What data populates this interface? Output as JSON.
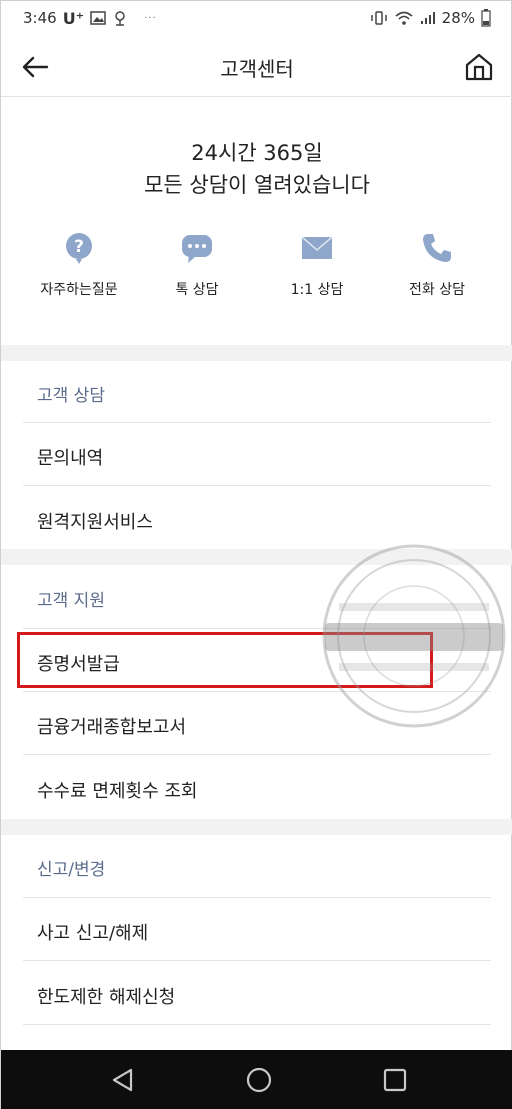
{
  "status": {
    "time": "3:46",
    "carrier": "U⁺",
    "more": "···",
    "battery": "28%"
  },
  "appbar": {
    "title": "고객센터"
  },
  "hero": {
    "line1": "24시간 365일",
    "line2": "모든 상담이 열려있습니다"
  },
  "quick_actions": [
    {
      "label": "자주하는질문",
      "icon": "question-bubble-icon"
    },
    {
      "label": "톡 상담",
      "icon": "chat-bubble-icon"
    },
    {
      "label": "1:1 상담",
      "icon": "mail-icon"
    },
    {
      "label": "전화 상담",
      "icon": "phone-icon"
    }
  ],
  "sections": [
    {
      "title": "고객 상담",
      "items": [
        "문의내역",
        "원격지원서비스"
      ]
    },
    {
      "title": "고객 지원",
      "items": [
        "증명서발급",
        "금융거래종합보고서",
        "수수료 면제횟수 조회"
      ]
    },
    {
      "title": "신고/변경",
      "items": [
        "사고 신고/해제",
        "한도제한 해제신청"
      ]
    }
  ],
  "colors": {
    "section_title": "#5a6b8c",
    "icon_blue": "#8ea6c9",
    "highlight": "#d41b1b",
    "divider_bg": "#f2f2f2"
  }
}
